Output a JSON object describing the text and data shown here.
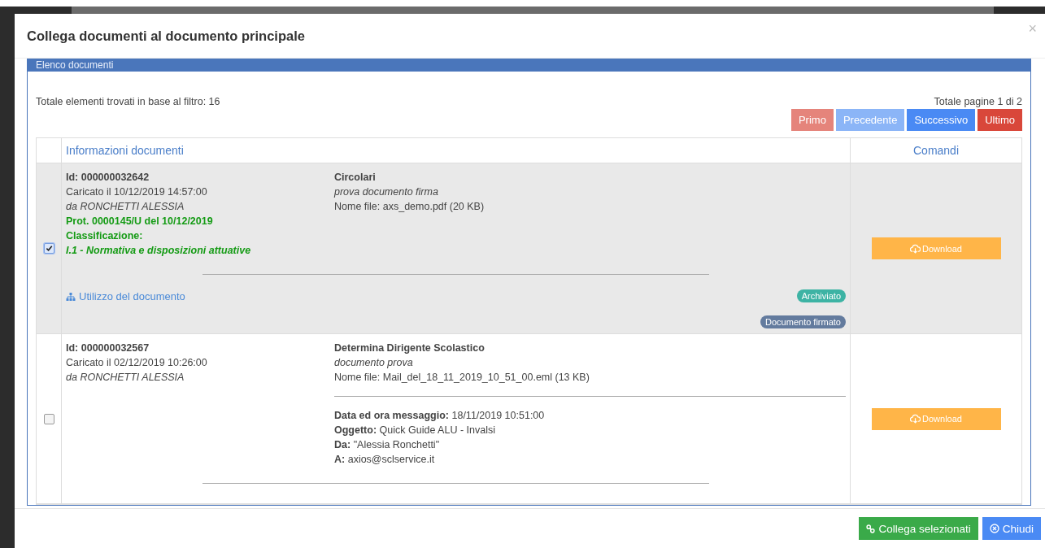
{
  "modal": {
    "title": "Collega documenti al documento principale",
    "close": "×"
  },
  "panel": {
    "title": "Elenco documenti",
    "total": "Totale elementi trovati in base al filtro: 16",
    "pages": "Totale pagine 1 di 2",
    "pager": [
      {
        "label": "Primo",
        "kind": "first"
      },
      {
        "label": "Precedente",
        "kind": "prev"
      },
      {
        "label": "Successivo",
        "kind": "next"
      },
      {
        "label": "Ultimo",
        "kind": "last"
      }
    ]
  },
  "table": {
    "columns": [
      "Informazioni documenti",
      "Comandi"
    ],
    "rows": [
      {
        "checked": true,
        "id": "Id: 000000032642",
        "uploaded": "Caricato il 10/12/2019 14:57:00",
        "author": "da RONCHETTI ALESSIA",
        "protocol": "Prot. 0000145/U del 10/12/2019",
        "classification_label": "Classificazione:",
        "classification": "I.1 - Normativa e disposizioni attuative",
        "category": "Circolari",
        "description": "prova documento firma",
        "filename": "Nome file: axs_demo.pdf (20 KB)",
        "usage_link": "Utilizzo del documento",
        "badges": [
          {
            "label": "Archiviato",
            "color": "#3db3a4"
          },
          {
            "label": "Documento firmato",
            "color": "#637b9e"
          }
        ],
        "download": "Download"
      },
      {
        "checked": false,
        "id": "Id: 000000032567",
        "uploaded": "Caricato il 02/12/2019 10:26:00",
        "author": "da RONCHETTI ALESSIA",
        "category": "Determina Dirigente Scolastico",
        "description": "documento prova",
        "filename": "Nome file: Mail_del_18_11_2019_10_51_00.eml (13 KB)",
        "email": [
          "**Data ed ora messaggio:** 18/11/2019 10:51:00",
          "**Oggetto:** Quick Guide ALU - Invalsi",
          "**Da:** \"Alessia Ronchetti\"",
          "**A:** axios@sclservice.it"
        ],
        "download": "Download"
      }
    ]
  },
  "footer": [
    {
      "label": "Collega selezionati",
      "kind": "link"
    },
    {
      "label": "Chiudi",
      "kind": "close"
    }
  ]
}
